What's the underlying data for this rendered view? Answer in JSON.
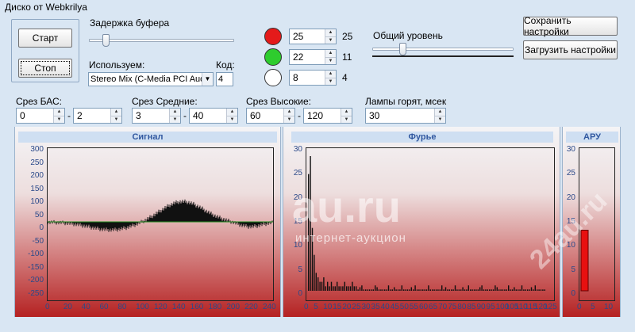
{
  "window": {
    "title": "Диско от Webkrilya"
  },
  "buttons": {
    "start": "Старт",
    "stop": "Стоп",
    "save": "Сохранить настройки",
    "load": "Загрузить настройки"
  },
  "buffer": {
    "label": "Задержка буфера",
    "level": 0.1
  },
  "source": {
    "label": "Используем:",
    "value": "Stereo Mix (C-Media PCI Audio",
    "code_label": "Код:",
    "code_value": "4"
  },
  "lamps": [
    {
      "color": "#e41a1a",
      "value": "25",
      "extra": "25"
    },
    {
      "color": "#2ecc2e",
      "value": "22",
      "extra": "11"
    },
    {
      "color": "#ffffff",
      "value": "8",
      "extra": "4"
    }
  ],
  "overall": {
    "label": "Общий уровень",
    "level": 0.2
  },
  "cuts": {
    "bass": {
      "label": "Срез БАС:",
      "from": "0",
      "to": "2"
    },
    "mid": {
      "label": "Срез Средние:",
      "from": "3",
      "to": "40"
    },
    "high": {
      "label": "Срез Высокие:",
      "from": "60",
      "to": "120"
    },
    "lamps_time": {
      "label": "Лампы горят, мсек",
      "value": "30"
    }
  },
  "signal": {
    "title": "Сигнал",
    "y_ticks": [
      "300",
      "250",
      "200",
      "150",
      "100",
      "50",
      "0",
      "-50",
      "-100",
      "-150",
      "-200",
      "-250"
    ],
    "x_ticks": [
      "0",
      "20",
      "40",
      "60",
      "80",
      "100",
      "120",
      "140",
      "160",
      "180",
      "200",
      "220",
      "240"
    ]
  },
  "fourier": {
    "title": "Фурье",
    "y_ticks": [
      "30",
      "25",
      "20",
      "15",
      "10",
      "5",
      "0"
    ],
    "x_ticks": [
      "0",
      "5",
      "10",
      "15",
      "20",
      "25",
      "30",
      "35",
      "40",
      "45",
      "50",
      "55",
      "60",
      "65",
      "70",
      "75",
      "80",
      "85",
      "90",
      "95",
      "100",
      "105",
      "110",
      "115",
      "120",
      "125"
    ]
  },
  "agc": {
    "title": "АРУ",
    "y_ticks": [
      "30",
      "25",
      "20",
      "15",
      "10",
      "5",
      "0"
    ],
    "x_ticks": [
      "0",
      "5",
      "10"
    ],
    "level": 13.5
  },
  "watermarks": {
    "main": "au.ru",
    "sub": "интернет-аукцион",
    "side": "24au.ru"
  }
}
